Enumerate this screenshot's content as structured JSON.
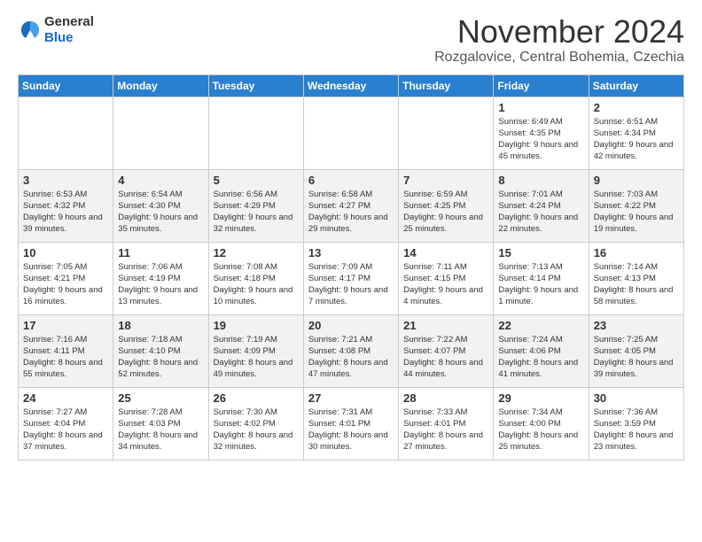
{
  "header": {
    "logo_general": "General",
    "logo_blue": "Blue",
    "month_title": "November 2024",
    "location": "Rozgalovice, Central Bohemia, Czechia"
  },
  "days_of_week": [
    "Sunday",
    "Monday",
    "Tuesday",
    "Wednesday",
    "Thursday",
    "Friday",
    "Saturday"
  ],
  "weeks": [
    [
      {
        "day": "",
        "info": ""
      },
      {
        "day": "",
        "info": ""
      },
      {
        "day": "",
        "info": ""
      },
      {
        "day": "",
        "info": ""
      },
      {
        "day": "",
        "info": ""
      },
      {
        "day": "1",
        "info": "Sunrise: 6:49 AM\nSunset: 4:35 PM\nDaylight: 9 hours and 45 minutes."
      },
      {
        "day": "2",
        "info": "Sunrise: 6:51 AM\nSunset: 4:34 PM\nDaylight: 9 hours and 42 minutes."
      }
    ],
    [
      {
        "day": "3",
        "info": "Sunrise: 6:53 AM\nSunset: 4:32 PM\nDaylight: 9 hours and 39 minutes."
      },
      {
        "day": "4",
        "info": "Sunrise: 6:54 AM\nSunset: 4:30 PM\nDaylight: 9 hours and 35 minutes."
      },
      {
        "day": "5",
        "info": "Sunrise: 6:56 AM\nSunset: 4:29 PM\nDaylight: 9 hours and 32 minutes."
      },
      {
        "day": "6",
        "info": "Sunrise: 6:58 AM\nSunset: 4:27 PM\nDaylight: 9 hours and 29 minutes."
      },
      {
        "day": "7",
        "info": "Sunrise: 6:59 AM\nSunset: 4:25 PM\nDaylight: 9 hours and 25 minutes."
      },
      {
        "day": "8",
        "info": "Sunrise: 7:01 AM\nSunset: 4:24 PM\nDaylight: 9 hours and 22 minutes."
      },
      {
        "day": "9",
        "info": "Sunrise: 7:03 AM\nSunset: 4:22 PM\nDaylight: 9 hours and 19 minutes."
      }
    ],
    [
      {
        "day": "10",
        "info": "Sunrise: 7:05 AM\nSunset: 4:21 PM\nDaylight: 9 hours and 16 minutes."
      },
      {
        "day": "11",
        "info": "Sunrise: 7:06 AM\nSunset: 4:19 PM\nDaylight: 9 hours and 13 minutes."
      },
      {
        "day": "12",
        "info": "Sunrise: 7:08 AM\nSunset: 4:18 PM\nDaylight: 9 hours and 10 minutes."
      },
      {
        "day": "13",
        "info": "Sunrise: 7:09 AM\nSunset: 4:17 PM\nDaylight: 9 hours and 7 minutes."
      },
      {
        "day": "14",
        "info": "Sunrise: 7:11 AM\nSunset: 4:15 PM\nDaylight: 9 hours and 4 minutes."
      },
      {
        "day": "15",
        "info": "Sunrise: 7:13 AM\nSunset: 4:14 PM\nDaylight: 9 hours and 1 minute."
      },
      {
        "day": "16",
        "info": "Sunrise: 7:14 AM\nSunset: 4:13 PM\nDaylight: 8 hours and 58 minutes."
      }
    ],
    [
      {
        "day": "17",
        "info": "Sunrise: 7:16 AM\nSunset: 4:11 PM\nDaylight: 8 hours and 55 minutes."
      },
      {
        "day": "18",
        "info": "Sunrise: 7:18 AM\nSunset: 4:10 PM\nDaylight: 8 hours and 52 minutes."
      },
      {
        "day": "19",
        "info": "Sunrise: 7:19 AM\nSunset: 4:09 PM\nDaylight: 8 hours and 49 minutes."
      },
      {
        "day": "20",
        "info": "Sunrise: 7:21 AM\nSunset: 4:08 PM\nDaylight: 8 hours and 47 minutes."
      },
      {
        "day": "21",
        "info": "Sunrise: 7:22 AM\nSunset: 4:07 PM\nDaylight: 8 hours and 44 minutes."
      },
      {
        "day": "22",
        "info": "Sunrise: 7:24 AM\nSunset: 4:06 PM\nDaylight: 8 hours and 41 minutes."
      },
      {
        "day": "23",
        "info": "Sunrise: 7:25 AM\nSunset: 4:05 PM\nDaylight: 8 hours and 39 minutes."
      }
    ],
    [
      {
        "day": "24",
        "info": "Sunrise: 7:27 AM\nSunset: 4:04 PM\nDaylight: 8 hours and 37 minutes."
      },
      {
        "day": "25",
        "info": "Sunrise: 7:28 AM\nSunset: 4:03 PM\nDaylight: 8 hours and 34 minutes."
      },
      {
        "day": "26",
        "info": "Sunrise: 7:30 AM\nSunset: 4:02 PM\nDaylight: 8 hours and 32 minutes."
      },
      {
        "day": "27",
        "info": "Sunrise: 7:31 AM\nSunset: 4:01 PM\nDaylight: 8 hours and 30 minutes."
      },
      {
        "day": "28",
        "info": "Sunrise: 7:33 AM\nSunset: 4:01 PM\nDaylight: 8 hours and 27 minutes."
      },
      {
        "day": "29",
        "info": "Sunrise: 7:34 AM\nSunset: 4:00 PM\nDaylight: 8 hours and 25 minutes."
      },
      {
        "day": "30",
        "info": "Sunrise: 7:36 AM\nSunset: 3:59 PM\nDaylight: 8 hours and 23 minutes."
      }
    ]
  ]
}
